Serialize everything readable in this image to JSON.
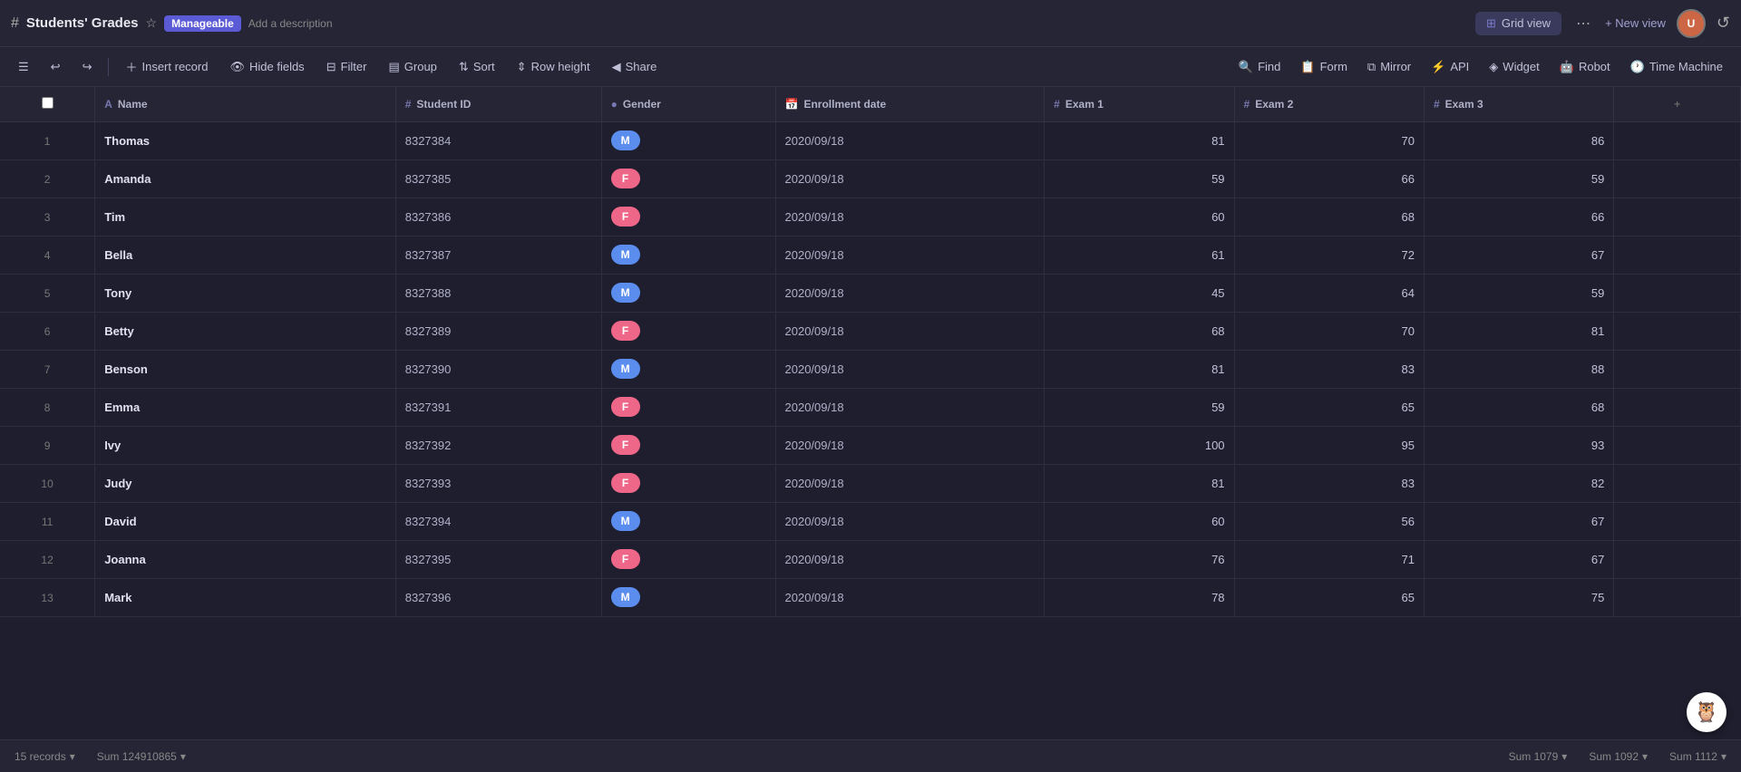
{
  "app": {
    "title": "Students' Grades",
    "badge": "Manageable",
    "description": "Add a description"
  },
  "topbar": {
    "view_label": "Grid view",
    "new_view_label": "+ New view",
    "more_icon": "⋯"
  },
  "toolbar": {
    "insert_record": "Insert record",
    "hide_fields": "Hide fields",
    "filter": "Filter",
    "group": "Group",
    "sort": "Sort",
    "row_height": "Row height",
    "share": "Share",
    "find": "Find",
    "form": "Form",
    "mirror": "Mirror",
    "api": "API",
    "widget": "Widget",
    "robot": "Robot",
    "time_machine": "Time Machine"
  },
  "table": {
    "columns": [
      {
        "id": "name",
        "label": "Name",
        "icon": "A",
        "type": "text"
      },
      {
        "id": "sid",
        "label": "Student ID",
        "icon": "#",
        "type": "number"
      },
      {
        "id": "gender",
        "label": "Gender",
        "icon": "●",
        "type": "special"
      },
      {
        "id": "enroll",
        "label": "Enrollment date",
        "icon": "📅",
        "type": "date"
      },
      {
        "id": "exam1",
        "label": "Exam 1",
        "icon": "#",
        "type": "number"
      },
      {
        "id": "exam2",
        "label": "Exam 2",
        "icon": "#",
        "type": "number"
      },
      {
        "id": "exam3",
        "label": "Exam 3",
        "icon": "#",
        "type": "number"
      }
    ],
    "rows": [
      {
        "id": 1,
        "name": "Thomas",
        "sid": "8327384",
        "gender": "M",
        "enroll": "2020/09/18",
        "exam1": 81,
        "exam2": 70,
        "exam3": 86
      },
      {
        "id": 2,
        "name": "Amanda",
        "sid": "8327385",
        "gender": "F",
        "enroll": "2020/09/18",
        "exam1": 59,
        "exam2": 66,
        "exam3": 59
      },
      {
        "id": 3,
        "name": "Tim",
        "sid": "8327386",
        "gender": "F",
        "enroll": "2020/09/18",
        "exam1": 60,
        "exam2": 68,
        "exam3": 66
      },
      {
        "id": 4,
        "name": "Bella",
        "sid": "8327387",
        "gender": "M",
        "enroll": "2020/09/18",
        "exam1": 61,
        "exam2": 72,
        "exam3": 67
      },
      {
        "id": 5,
        "name": "Tony",
        "sid": "8327388",
        "gender": "M",
        "enroll": "2020/09/18",
        "exam1": 45,
        "exam2": 64,
        "exam3": 59
      },
      {
        "id": 6,
        "name": "Betty",
        "sid": "8327389",
        "gender": "F",
        "enroll": "2020/09/18",
        "exam1": 68,
        "exam2": 70,
        "exam3": 81
      },
      {
        "id": 7,
        "name": "Benson",
        "sid": "8327390",
        "gender": "M",
        "enroll": "2020/09/18",
        "exam1": 81,
        "exam2": 83,
        "exam3": 88
      },
      {
        "id": 8,
        "name": "Emma",
        "sid": "8327391",
        "gender": "F",
        "enroll": "2020/09/18",
        "exam1": 59,
        "exam2": 65,
        "exam3": 68
      },
      {
        "id": 9,
        "name": "Ivy",
        "sid": "8327392",
        "gender": "F",
        "enroll": "2020/09/18",
        "exam1": 100,
        "exam2": 95,
        "exam3": 93
      },
      {
        "id": 10,
        "name": "Judy",
        "sid": "8327393",
        "gender": "F",
        "enroll": "2020/09/18",
        "exam1": 81,
        "exam2": 83,
        "exam3": 82
      },
      {
        "id": 11,
        "name": "David",
        "sid": "8327394",
        "gender": "M",
        "enroll": "2020/09/18",
        "exam1": 60,
        "exam2": 56,
        "exam3": 67
      },
      {
        "id": 12,
        "name": "Joanna",
        "sid": "8327395",
        "gender": "F",
        "enroll": "2020/09/18",
        "exam1": 76,
        "exam2": 71,
        "exam3": 67
      },
      {
        "id": 13,
        "name": "Mark",
        "sid": "8327396",
        "gender": "M",
        "enroll": "2020/09/18",
        "exam1": 78,
        "exam2": 65,
        "exam3": 75
      }
    ]
  },
  "statusbar": {
    "records": "15 records",
    "sum_sid": "Sum 124910865",
    "sum_exam1": "Sum 1079",
    "sum_exam2": "Sum 1092",
    "sum_exam3": "Sum 1112"
  }
}
